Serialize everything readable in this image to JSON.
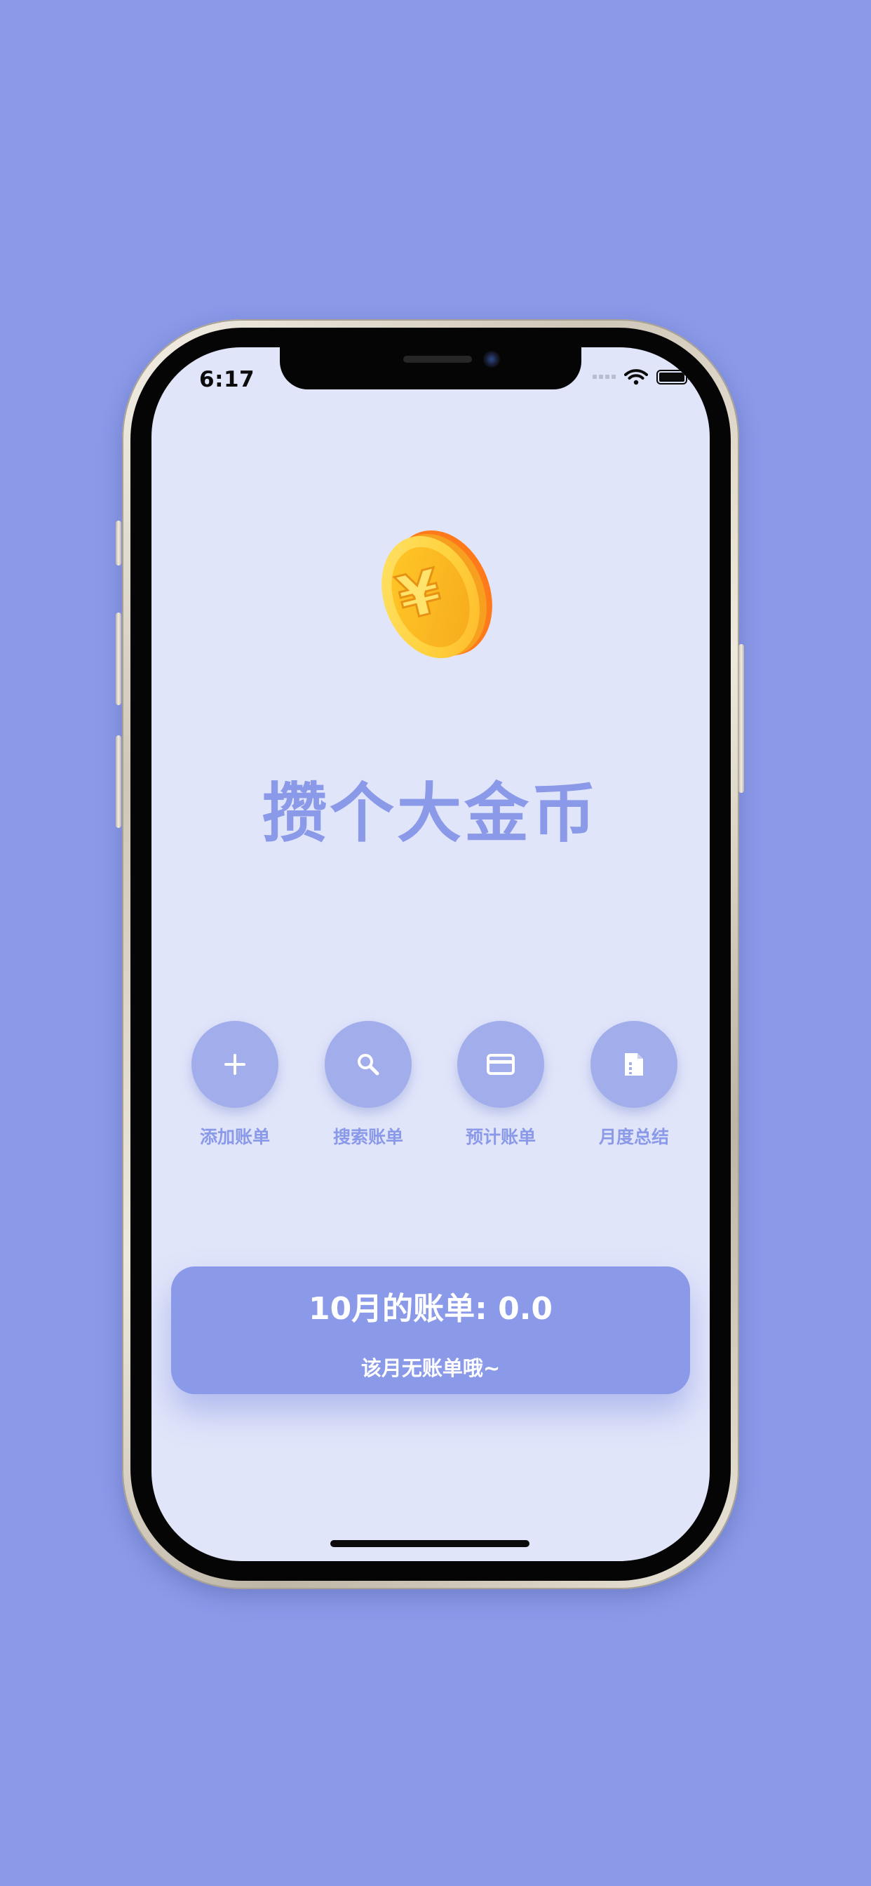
{
  "status_bar": {
    "time": "6:17",
    "icons": [
      "signal-dots-icon",
      "wifi-icon",
      "battery-icon"
    ]
  },
  "app": {
    "logo_icon": "yen-coin-icon",
    "logo_glyph": "¥",
    "title": "攒个大金币"
  },
  "actions": [
    {
      "icon": "plus-icon",
      "label": "添加账单"
    },
    {
      "icon": "search-icon",
      "label": "搜索账单"
    },
    {
      "icon": "credit-card-icon",
      "label": "预计账单"
    },
    {
      "icon": "document-icon",
      "label": "月度总结"
    }
  ],
  "bill_card": {
    "title": "10月的账单: 0.0",
    "subtitle": "该月无账单哦~"
  },
  "colors": {
    "background": "#8a99e8",
    "screen": "#e1e5fa",
    "accent": "#8a99e8",
    "button_fill": "#a2aeec",
    "coin_gold": "#fbc02d",
    "coin_orange": "#ff7a1a"
  }
}
